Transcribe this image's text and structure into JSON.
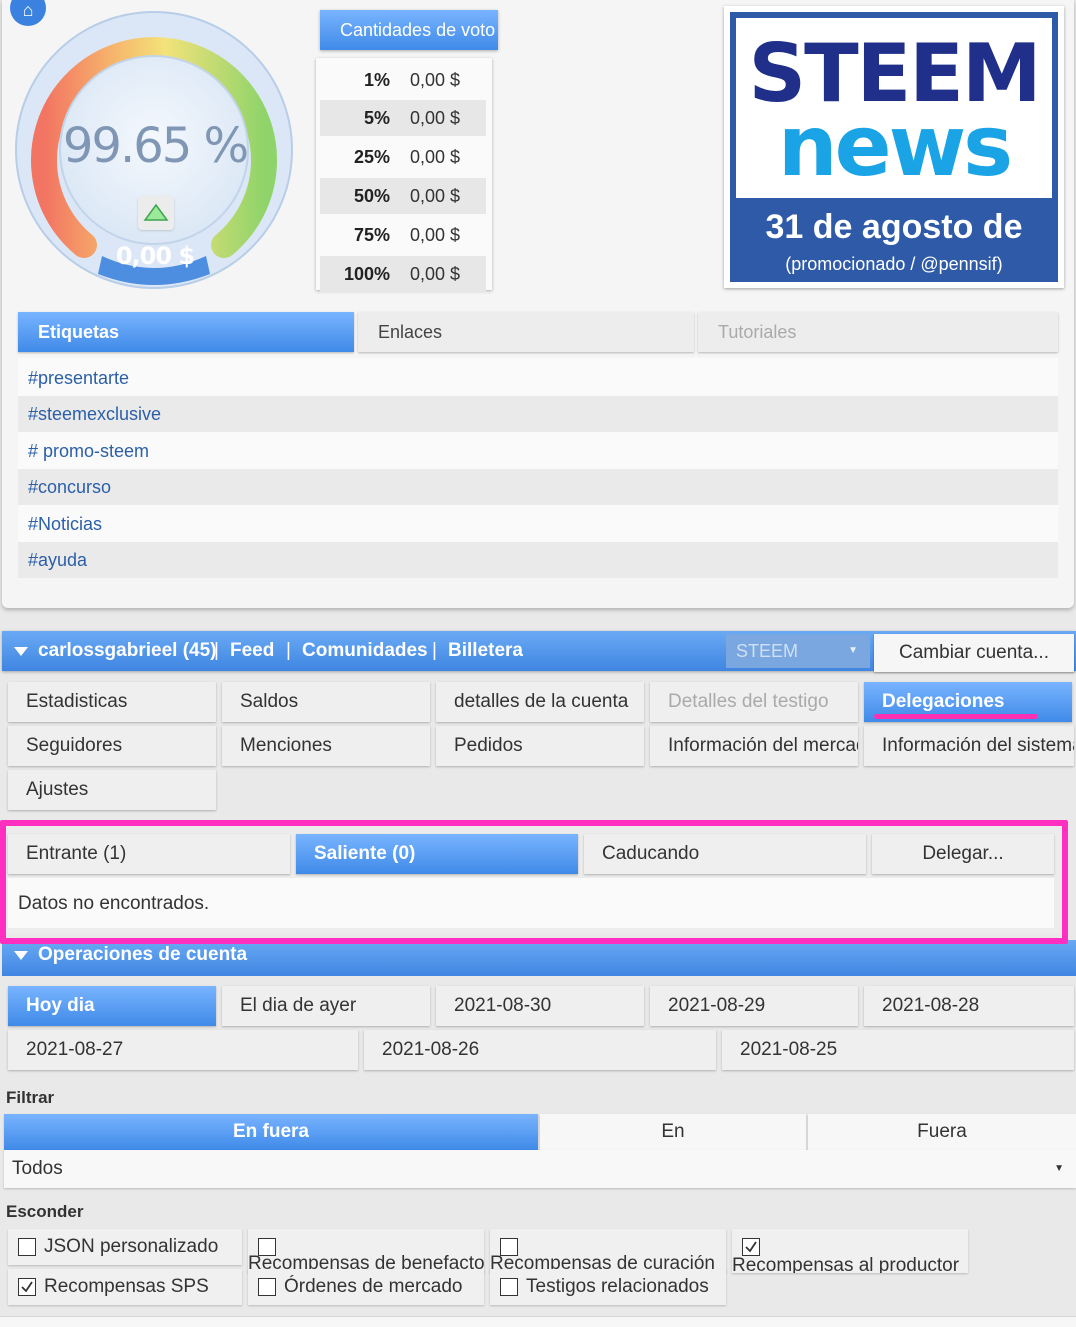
{
  "gauge": {
    "percent": "99.65 %",
    "value": "0,00 $",
    "level": 0.9965
  },
  "vote_amounts": {
    "title": "Cantidades de voto",
    "rows": [
      {
        "pct": "1%",
        "amount": "0,00 $"
      },
      {
        "pct": "5%",
        "amount": "0,00 $"
      },
      {
        "pct": "25%",
        "amount": "0,00 $"
      },
      {
        "pct": "50%",
        "amount": "0,00 $"
      },
      {
        "pct": "75%",
        "amount": "0,00 $"
      },
      {
        "pct": "100%",
        "amount": "0,00 $"
      }
    ]
  },
  "news": {
    "logo_line1": "STEEM",
    "logo_line2": "news",
    "title": "31 de agosto de",
    "subtitle": "(promocionado / @pennsif)"
  },
  "tag_tabs": [
    "Etiquetas",
    "Enlaces",
    "Tutoriales"
  ],
  "tags": [
    "#presentarte",
    "#steemexclusive",
    "# promo-steem",
    "#concurso",
    "#Noticias",
    "#ayuda"
  ],
  "account_bar": {
    "user": "carlossgabrieel (45)",
    "sep": "|",
    "feed": "Feed",
    "communities": "Comunidades",
    "wallet": "Billetera",
    "chain_select": "STEEM",
    "switch_button": "Cambiar cuenta..."
  },
  "account_tabs": {
    "row1": [
      "Estadisticas",
      "Saldos",
      "detalles de la cuenta",
      "Detalles del testigo",
      "Delegaciones"
    ],
    "row2": [
      "Seguidores",
      "Menciones",
      "Pedidos",
      "Información del mercad",
      "Información del sistema"
    ],
    "row3": [
      "Ajustes"
    ]
  },
  "delegations": {
    "tabs": [
      "Entrante (1)",
      "Saliente (0)",
      "Caducando"
    ],
    "delegate_button": "Delegar...",
    "empty_text": "Datos no encontrados."
  },
  "operations": {
    "title": "Operaciones de cuenta",
    "days_row1": [
      "Hoy dia",
      "El dia de ayer",
      "2021-08-30",
      "2021-08-29",
      "2021-08-28"
    ],
    "days_row2": [
      "2021-08-27",
      "2021-08-26",
      "2021-08-25"
    ],
    "filter_label": "Filtrar",
    "filter_segments": [
      "En fuera",
      "En",
      "Fuera"
    ],
    "type_select": "Todos",
    "hide_label": "Esconder",
    "hide_options": [
      {
        "label": "JSON personalizado",
        "checked": false
      },
      {
        "label": "Recompensas de benefactor",
        "checked": false
      },
      {
        "label": "Recompensas de curación",
        "checked": false
      },
      {
        "label": "Recompensas al productor",
        "checked": true
      },
      {
        "label": "Recompensas SPS",
        "checked": true
      },
      {
        "label": "Órdenes de mercado",
        "checked": false
      },
      {
        "label": "Testigos relacionados",
        "checked": false
      }
    ]
  },
  "colors": {
    "accent_blue": "#3f8ae8",
    "highlight_pink": "#ff2fc0",
    "link_blue": "#2b5fa8",
    "news_navy": "#2f5aa8"
  }
}
